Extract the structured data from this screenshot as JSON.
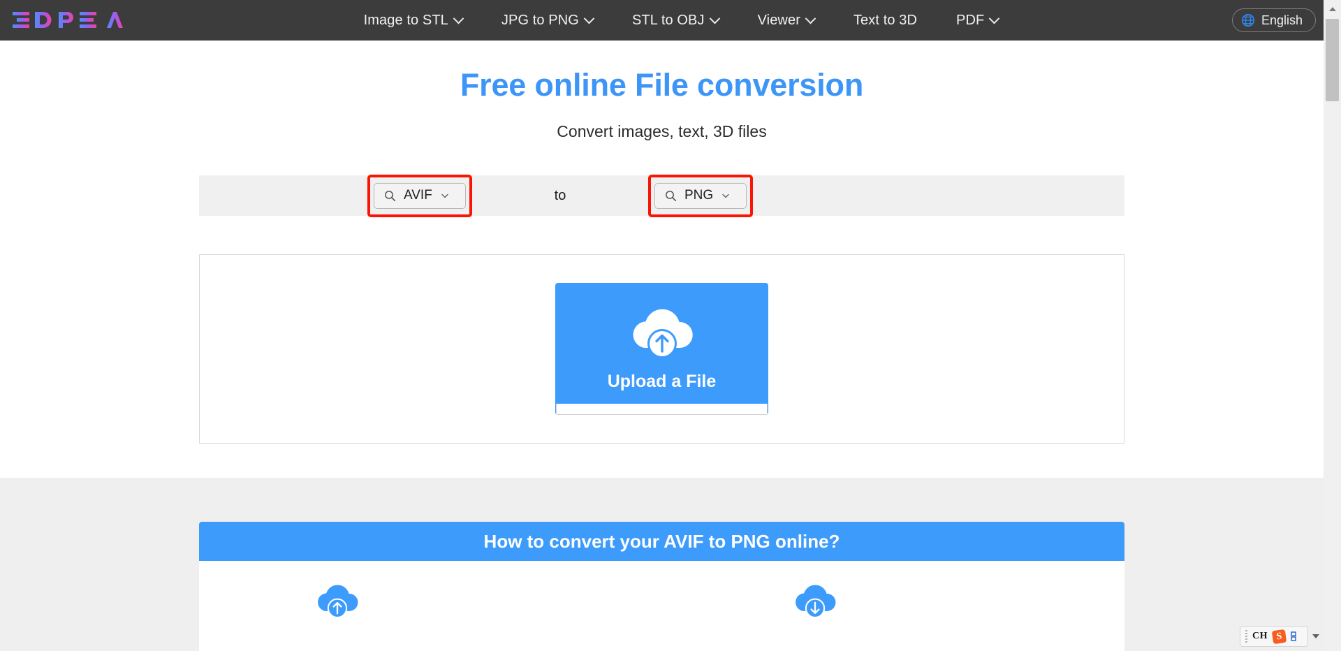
{
  "nav": {
    "logo_text": "3DPEA",
    "items": [
      {
        "label": "Image to STL",
        "has_dropdown": true
      },
      {
        "label": "JPG to PNG",
        "has_dropdown": true
      },
      {
        "label": "STL to OBJ",
        "has_dropdown": true
      },
      {
        "label": "Viewer",
        "has_dropdown": true
      },
      {
        "label": "Text to 3D",
        "has_dropdown": false
      },
      {
        "label": "PDF",
        "has_dropdown": true
      }
    ],
    "language": {
      "label": "English",
      "icon": "globe-icon"
    },
    "background_color": "#3c3c3c"
  },
  "hero": {
    "title": "Free online File conversion",
    "subtitle": "Convert images, text, 3D files",
    "title_color": "#3d96f7"
  },
  "converter": {
    "source_format": "AVIF",
    "target_format": "PNG",
    "separator_label": "to",
    "search_icon": "search-icon",
    "chevron_icon": "chevron-down-icon",
    "highlight_color": "#fb1404",
    "bar_background": "#f0f0f0"
  },
  "upload": {
    "button_label": "Upload a File",
    "icon": "cloud-upload-icon",
    "button_color": "#3d9bfb"
  },
  "howto": {
    "heading": "How to convert your AVIF to PNG online?",
    "header_color": "#3d9bfb",
    "steps": [
      {
        "icon": "cloud-upload-icon"
      },
      {
        "icon": "cloud-download-icon"
      }
    ]
  },
  "scrollbar": {
    "up_arrow_icon": "triangle-up-icon"
  },
  "ime": {
    "mode_label": "CH",
    "app_logo": "sogou-logo-icon",
    "keyboard_icon": "keyboard-icon",
    "expand_icon": "caret-down-icon"
  }
}
